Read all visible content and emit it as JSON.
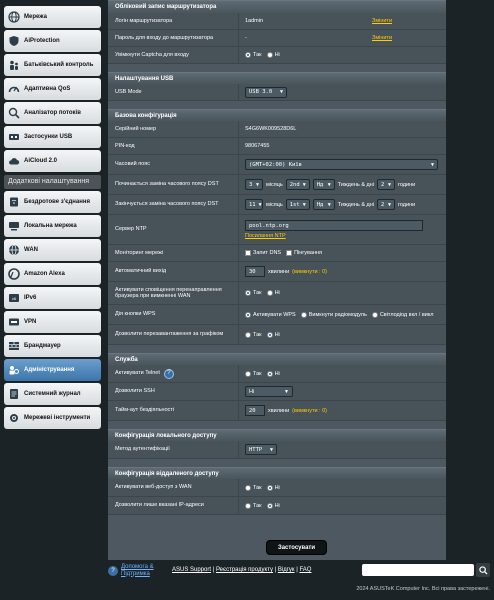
{
  "sidebar": {
    "items_top": [
      {
        "label": "Мережа",
        "icon": "globe-icon"
      },
      {
        "label": "AiProtection",
        "icon": "shield-icon"
      },
      {
        "label": "Батьківський контроль",
        "icon": "family-icon"
      },
      {
        "label": "Адаптивна QoS",
        "icon": "speedometer-icon"
      },
      {
        "label": "Аналізатор потоків",
        "icon": "traffic-analyzer-icon"
      },
      {
        "label": "Застосунки USB",
        "icon": "usb-apps-icon"
      },
      {
        "label": "AiCloud 2.0",
        "icon": "cloud-icon"
      }
    ],
    "section_label": "Додаткові налаштування",
    "items_adv": [
      {
        "label": "Бездротове з'єднання",
        "icon": "wifi-icon"
      },
      {
        "label": "Локальна мережа",
        "icon": "lan-icon"
      },
      {
        "label": "WAN",
        "icon": "wan-globe-icon"
      },
      {
        "label": "Amazon Alexa",
        "icon": "alexa-icon"
      },
      {
        "label": "IPv6",
        "icon": "ipv6-icon"
      },
      {
        "label": "VPN",
        "icon": "vpn-icon"
      },
      {
        "label": "Брандмауер",
        "icon": "firewall-icon"
      },
      {
        "label": "Адміністрування",
        "icon": "admin-icon"
      },
      {
        "label": "Системний журнал",
        "icon": "log-icon"
      },
      {
        "label": "Мережеві інструменти",
        "icon": "tools-icon"
      }
    ]
  },
  "account": {
    "title": "Обліковий запис маршрутизатора",
    "login_label": "Логін маршрутизатора",
    "login_value": "1admin",
    "password_label": "Пароль для входу до маршрутизатора",
    "password_value": "-",
    "change": "Змінити",
    "captcha_label": "Увімкнути Captcha для входу",
    "yes": "Так",
    "no": "Ні"
  },
  "usb": {
    "title": "Налаштування USB",
    "mode_label": "USB Mode",
    "mode_value": "USB 3.0"
  },
  "basic": {
    "title": "Базова конфігурація",
    "serial_label": "Серійний номер",
    "serial_value": "S4G6WK009528D6L",
    "pin_label": "PIN-код",
    "pin_value": "98067455",
    "tz_label": "Часовий пояс",
    "tz_value": "(GMT+02:00) Київ",
    "dst_start_label": "Починається заміна часового поясу DST",
    "dst_start": {
      "a": "3",
      "b": "2nd",
      "c": "Нд",
      "d": "2"
    },
    "dst_end_label": "Закінчується заміна часового поясу DST",
    "dst_end": {
      "a": "11",
      "b": "1st",
      "c": "Нд",
      "d": "2"
    },
    "month": "місяць",
    "week_day": "Тиждень & дні",
    "hour": "години",
    "ntp_label": "Сервер NTP",
    "ntp_value": "pool.ntp.org",
    "ntp_link": "Посилання NTP",
    "monitor_label": "Моніторинг мережі",
    "dns_query": "Запит DNS",
    "ping": "Пінгування",
    "logout_label": "Автоматичний вихід",
    "logout_value": "30",
    "minutes": "хвилини",
    "disable_note": "(вимкнути : 0)",
    "redirect_label": "Активувати сповіщення перенаправлення браузера при вимкненні WAN",
    "wps_label": "Дія кнопки WPS",
    "wps_opt1": "Активувати WPS",
    "wps_opt2": "Вимкнути радіомодуль",
    "wps_opt3": "Світлодіод вкл / викл",
    "reboot_label": "Дозволити перезавантаження за графіком"
  },
  "service": {
    "title": "Служба",
    "telnet_label": "Активувати Telnet",
    "ssh_label": "Дозволити SSH",
    "ssh_value": "Ні",
    "idle_label": "Тайм-аут бездіяльності",
    "idle_value": "20",
    "minutes": "хвилини",
    "disable_note": "(вимкнути : 0)"
  },
  "local": {
    "title": "Конфігурація локального доступу",
    "auth_label": "Метод аутентифікації",
    "auth_value": "HTTP"
  },
  "remote": {
    "title": "Конфігурація віддаленого доступу",
    "web_wan_label": "Активувати веб-доступ з WAN",
    "only_ip_label": "Дозволити лише вказані IP-адреси"
  },
  "apply_label": "Застосувати",
  "footer": {
    "help": "Допомога & Підтримка",
    "links": [
      "ASUS Support",
      "Реєстрація продукту",
      "Відгук",
      "FAQ"
    ],
    "copyright": "2024 ASUSTeK Computer Inc. Всі права застережені."
  }
}
